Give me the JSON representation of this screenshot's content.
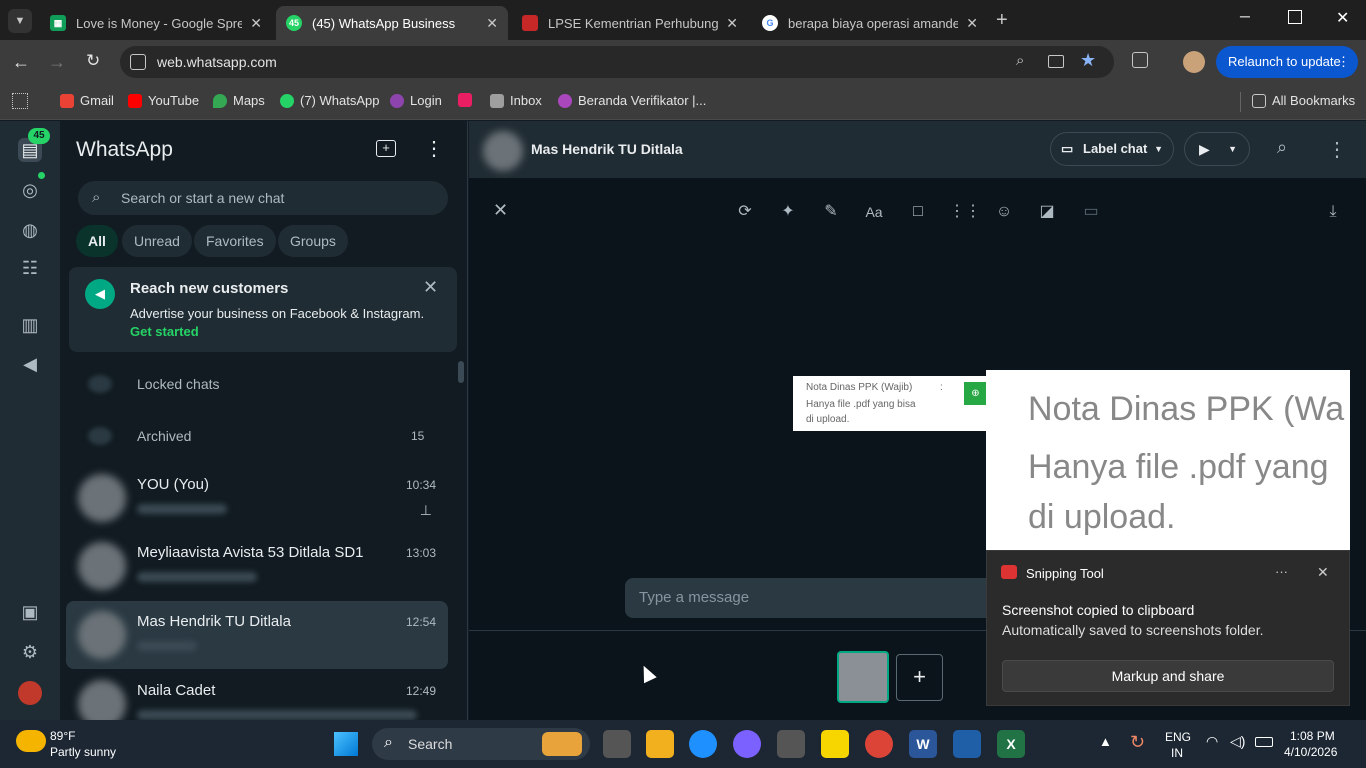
{
  "browser": {
    "tabs": [
      {
        "title": "Love is Money - Google Spread",
        "color": "#0f9d58",
        "active": false
      },
      {
        "title": "(45) WhatsApp Business",
        "color": "#25d366",
        "badge": "45",
        "active": true
      },
      {
        "title": "LPSE Kementrian Perhubungan",
        "color": "#c62828",
        "active": false
      },
      {
        "title": "berapa biaya operasi amandel -",
        "color": "#ffffff",
        "active": false
      }
    ],
    "url": "web.whatsapp.com",
    "relaunch_label": "Relaunch to update",
    "bookmarks": [
      {
        "label": "Gmail",
        "color": "#ea4335"
      },
      {
        "label": "YouTube",
        "color": "#ff0000"
      },
      {
        "label": "Maps",
        "color": "#34a853"
      },
      {
        "label": "(7) WhatsApp",
        "color": "#25d366"
      },
      {
        "label": "Login",
        "color": "#8e44ad"
      },
      {
        "label": "",
        "color": "#e91e63"
      },
      {
        "label": "Inbox",
        "color": "#9e9e9e"
      },
      {
        "label": "Beranda Verifikator |...",
        "color": "#ab47bc"
      }
    ],
    "all_bookmarks": "All Bookmarks"
  },
  "whatsapp": {
    "nav_badge": "45",
    "title": "WhatsApp",
    "search_placeholder": "Search or start a new chat",
    "filters": [
      "All",
      "Unread",
      "Favorites",
      "Groups"
    ],
    "promo": {
      "title": "Reach new customers",
      "body": "Advertise your business on Facebook & Instagram.",
      "link": "Get started"
    },
    "locked": "Locked chats",
    "archived": "Archived",
    "archived_count": "15",
    "chats": [
      {
        "name": "YOU (You)",
        "time": "10:34",
        "pinned": true
      },
      {
        "name": "Meyliaavista Avista 53 Ditlala SD1",
        "time": "13:03"
      },
      {
        "name": "Mas Hendrik TU Ditlala",
        "time": "12:54",
        "selected": true
      },
      {
        "name": "Naila Cadet",
        "time": "12:49"
      }
    ],
    "header": {
      "contact": "Mas Hendrik TU Ditlala",
      "label_chat": "Label chat"
    },
    "editor": {
      "image_text_1": "Nota Dinas PPK (Wajib)",
      "image_text_colon": ":",
      "image_text_2": "Hanya file .pdf yang bisa",
      "image_text_3": "di upload.",
      "message_placeholder": "Type a message",
      "add_label": "+"
    }
  },
  "snipping": {
    "preview_line1": "Nota Dinas PPK (Wa",
    "preview_line2": "Hanya file .pdf yang",
    "preview_line3": "di upload.",
    "app": "Snipping Tool",
    "title": "Screenshot copied to clipboard",
    "body": "Automatically saved to screenshots folder.",
    "button": "Markup and share",
    "more": "···"
  },
  "taskbar": {
    "temp": "89°F",
    "weather": "Partly sunny",
    "search": "Search",
    "lang1": "ENG",
    "lang2": "IN",
    "time": "1:08 PM",
    "date": "4/10/2026"
  }
}
